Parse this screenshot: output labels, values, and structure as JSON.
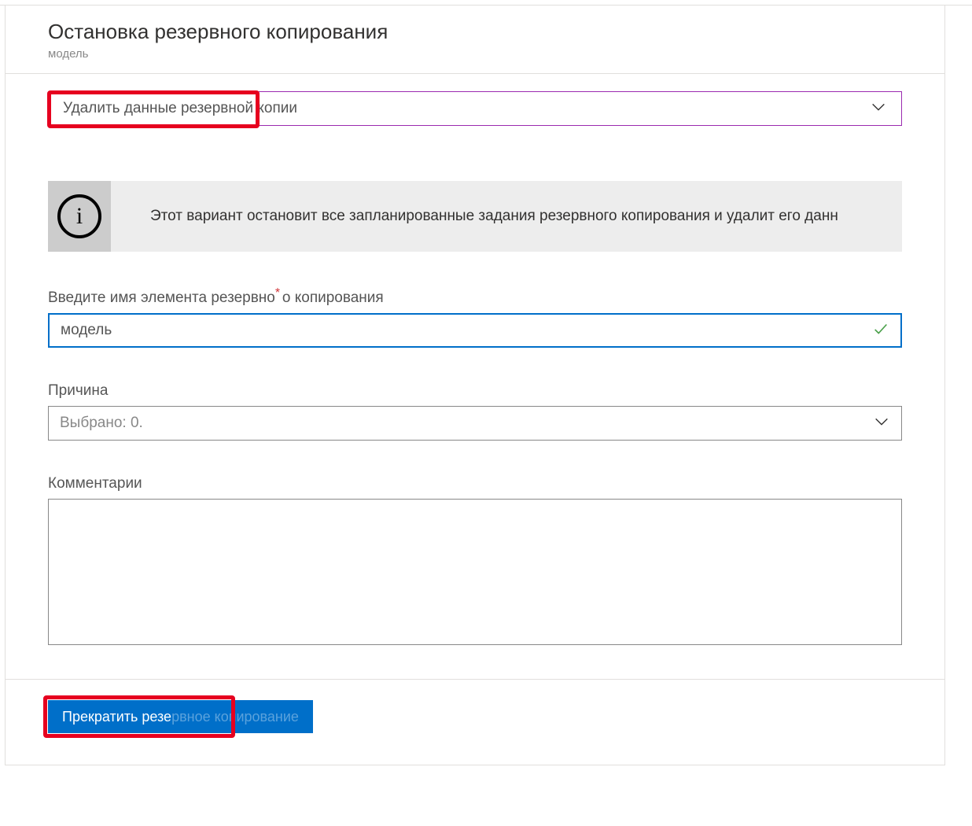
{
  "header": {
    "title": "Остановка резервного копирования",
    "subtitle": "модель"
  },
  "actionDropdown": {
    "selected": "Удалить данные резервной копии"
  },
  "infoBanner": {
    "icon": "i",
    "message": "Этот вариант остановит все запланированные задания резервного копирования и удалит его данн"
  },
  "nameField": {
    "label": "Введите имя элемента резервного копирования",
    "labelPrefix": "Введите имя элемента резервно",
    "labelSuffix": "о копирования",
    "asterisk": "*",
    "value": "модель"
  },
  "reasonField": {
    "label": "Причина",
    "selected": "Выбрано: 0."
  },
  "commentsField": {
    "label": "Комментарии"
  },
  "footer": {
    "buttonVisible": "Прекратить резе",
    "buttonFaded": "рвное копирование"
  }
}
